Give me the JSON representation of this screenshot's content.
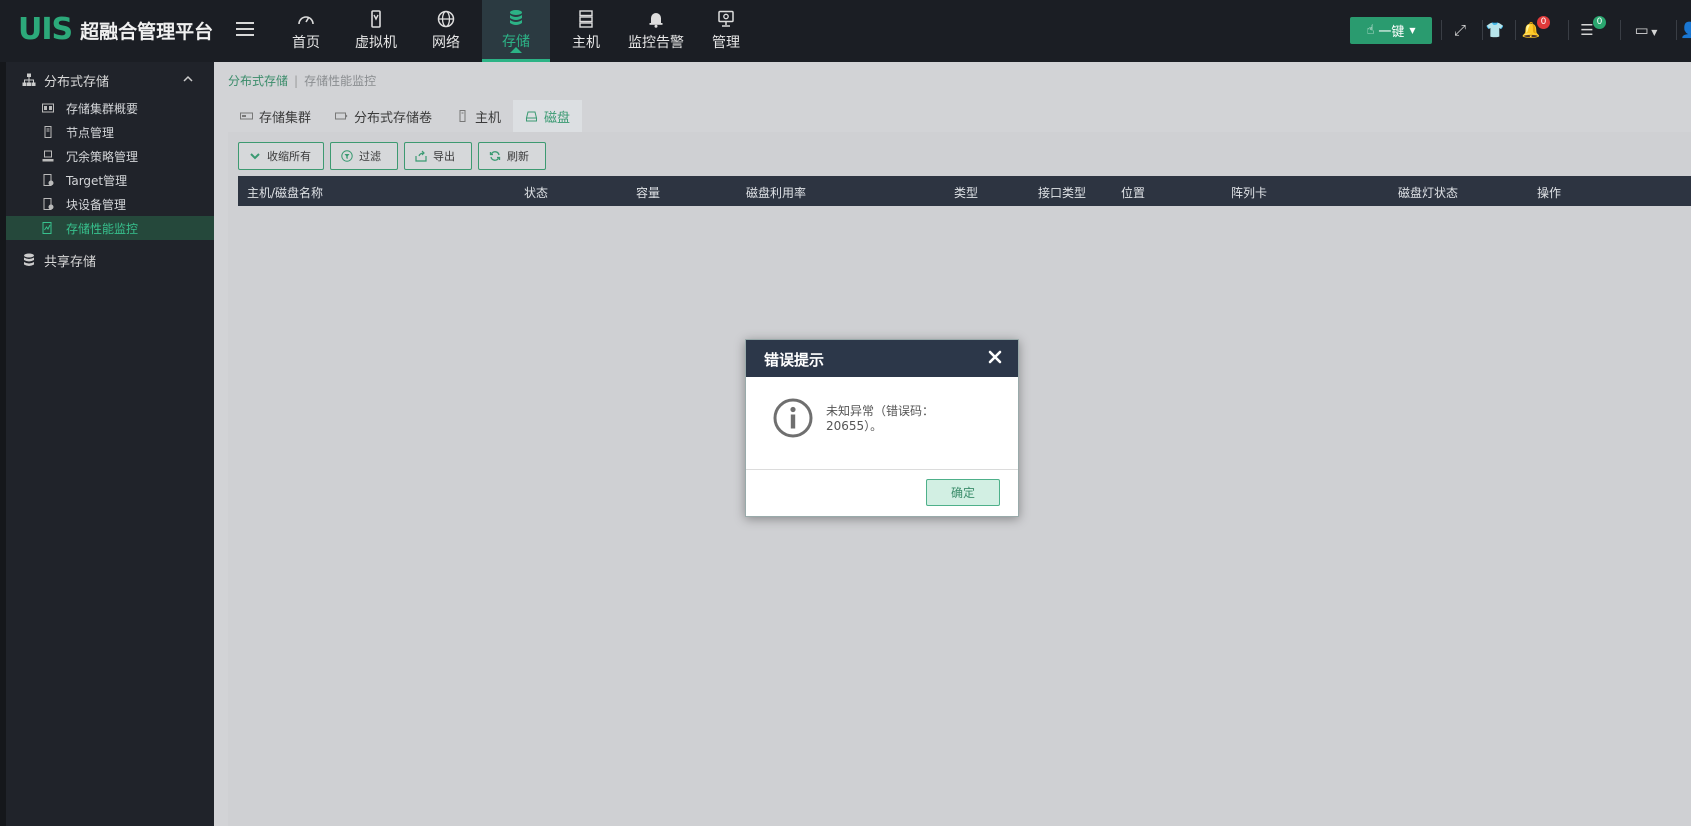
{
  "app": {
    "logo": "UIS",
    "title": "超融合管理平台"
  },
  "nav": [
    {
      "label": "首页",
      "icon": "dashboard-icon"
    },
    {
      "label": "虚拟机",
      "icon": "vm-icon"
    },
    {
      "label": "网络",
      "icon": "globe-icon"
    },
    {
      "label": "存储",
      "icon": "database-icon",
      "active": true
    },
    {
      "label": "主机",
      "icon": "server-icon"
    },
    {
      "label": "监控告警",
      "icon": "bell-icon"
    },
    {
      "label": "管理",
      "icon": "monitor-icon"
    }
  ],
  "topright": {
    "onekey_label": "一键",
    "notifications_badge": "0",
    "tasks_badge": "0"
  },
  "sidebar": {
    "groups": [
      {
        "label": "分布式存储",
        "expanded": true,
        "items": [
          {
            "label": "存储集群概要"
          },
          {
            "label": "节点管理"
          },
          {
            "label": "冗余策略管理"
          },
          {
            "label": "Target管理"
          },
          {
            "label": "块设备管理"
          },
          {
            "label": "存储性能监控",
            "active": true
          }
        ]
      },
      {
        "label": "共享存储",
        "expanded": false,
        "items": []
      }
    ]
  },
  "breadcrumb": {
    "parent": "分布式存储",
    "current": "存储性能监控"
  },
  "tabs": [
    {
      "label": "存储集群"
    },
    {
      "label": "分布式存储卷"
    },
    {
      "label": "主机"
    },
    {
      "label": "磁盘",
      "active": true
    }
  ],
  "toolbar": {
    "collapse_all": "收缩所有",
    "filter": "过滤",
    "export": "导出",
    "refresh": "刷新"
  },
  "table": {
    "columns": [
      "主机/磁盘名称",
      "状态",
      "容量",
      "磁盘利用率",
      "类型",
      "接口类型",
      "位置",
      "阵列卡",
      "磁盘灯状态",
      "操作"
    ],
    "rows": []
  },
  "modal": {
    "title": "错误提示",
    "message": "未知异常（错误码：20655）。",
    "ok_label": "确定"
  },
  "colors": {
    "accent": "#2cb386",
    "topbar": "#1b1e24",
    "modal_header": "#2c3749"
  }
}
